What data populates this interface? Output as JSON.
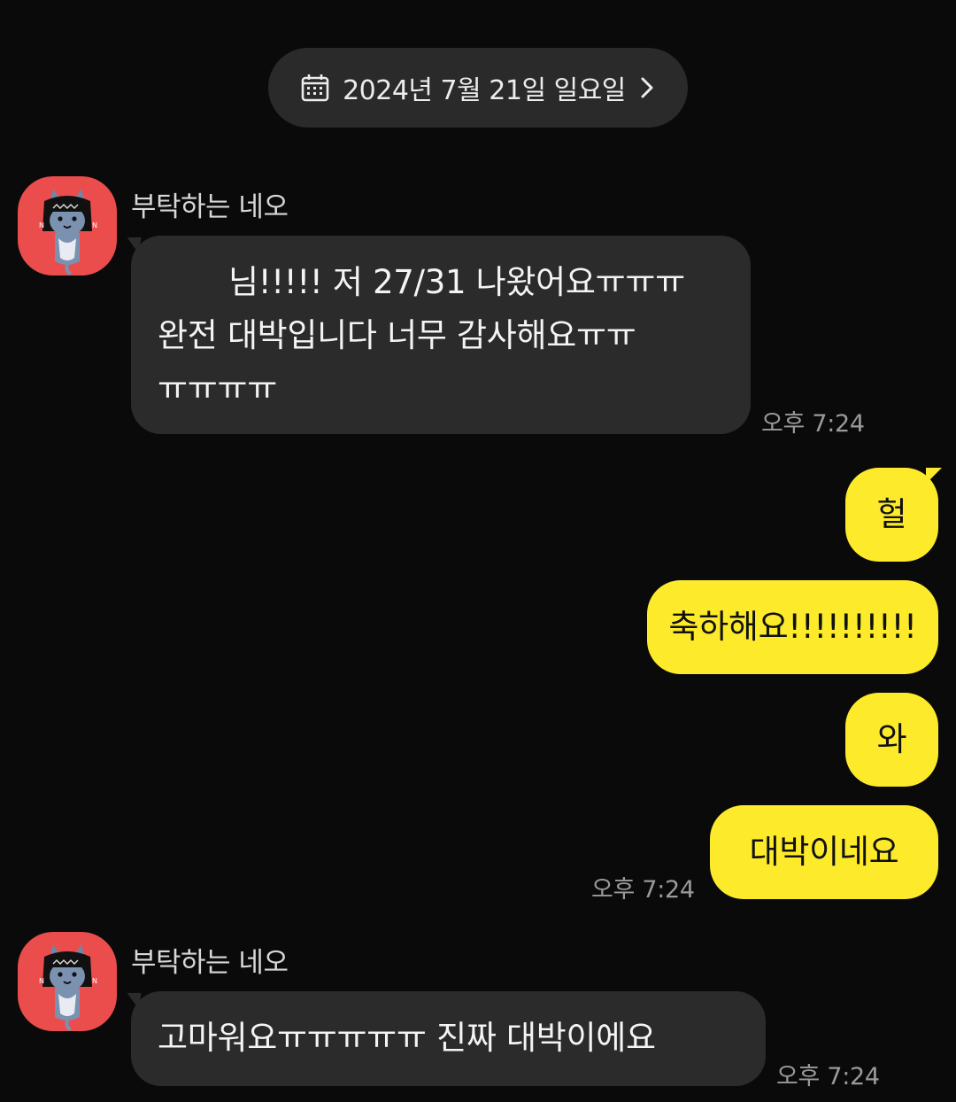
{
  "date_pill": {
    "icon": "calendar-icon",
    "label": "2024년 7월 21일 일요일",
    "chevron": "chevron-right-icon"
  },
  "colors": {
    "background": "#0a0a0a",
    "incoming_bubble": "#2b2b2b",
    "outgoing_bubble": "#fdeb2b",
    "avatar_bg": "#ea4d4c"
  },
  "messages": [
    {
      "direction": "incoming",
      "sender": "부탁하는 네오",
      "avatar_icon": "neo-character-avatar",
      "lines": [
        "님!!!!! 저 27/31 나왔어요ㅠㅠㅠ",
        "완전 대박입니다 너무 감사해요ㅠㅠ",
        "ㅠㅠㅠㅠ"
      ],
      "time": "오후 7:24"
    },
    {
      "direction": "outgoing",
      "bubbles": [
        "헐",
        "축하해요!!!!!!!!!!",
        "와",
        "대박이네요"
      ],
      "time": "오후 7:24"
    },
    {
      "direction": "incoming",
      "sender": "부탁하는 네오",
      "avatar_icon": "neo-character-avatar",
      "lines": [
        "고마워요ㅠㅠㅠㅠㅠ 진짜 대박이에요"
      ],
      "time": "오후 7:24"
    }
  ]
}
